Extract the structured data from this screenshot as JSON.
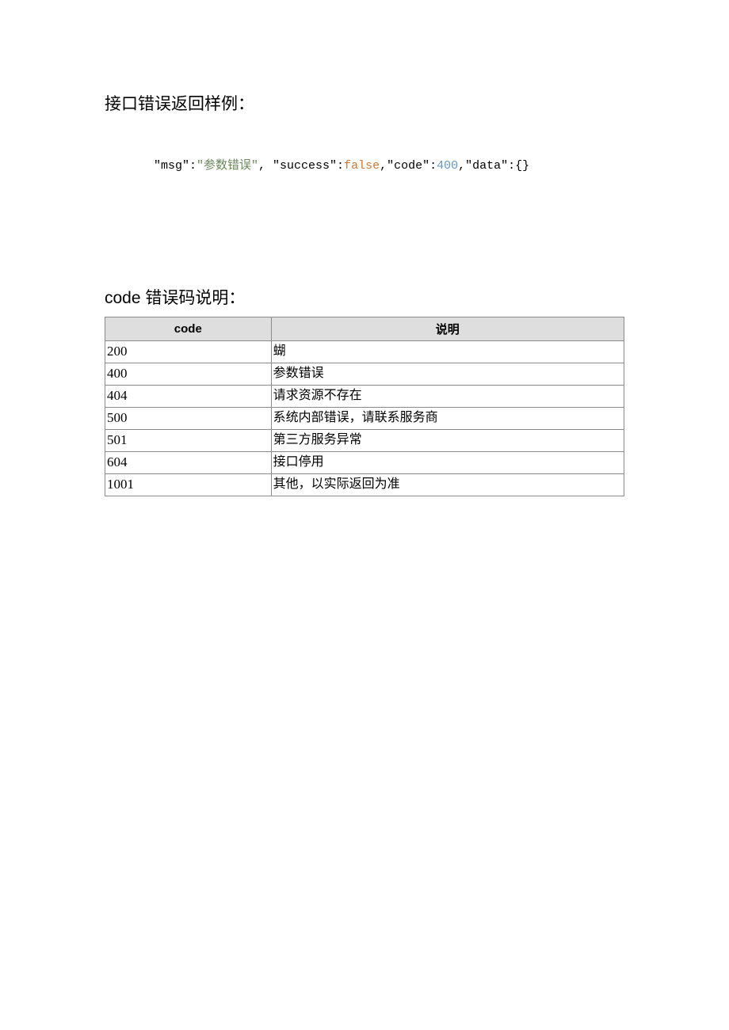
{
  "section1": {
    "title": "接口错误返回样例：",
    "sample": {
      "p1": "\"msg\":",
      "p2": "\"参数错误\"",
      "p3": ", \"success\":",
      "p4": "false",
      "p5": ",",
      "p6": "\"code\":",
      "p7": "400",
      "p8": ",\"data\":{}"
    }
  },
  "section2": {
    "title": "code 错误码说明：",
    "headers": {
      "code": "code",
      "desc": "说明"
    },
    "rows": [
      {
        "code": "200",
        "desc": "蝴"
      },
      {
        "code": "400",
        "desc": "参数错误"
      },
      {
        "code": "404",
        "desc": "请求资源不存在"
      },
      {
        "code": "500",
        "desc": "系统内部错误，请联系服务商"
      },
      {
        "code": "501",
        "desc": "第三方服务异常"
      },
      {
        "code": "604",
        "desc": "接口停用"
      },
      {
        "code": "1001",
        "desc": "其他，以实际返回为准"
      }
    ]
  }
}
